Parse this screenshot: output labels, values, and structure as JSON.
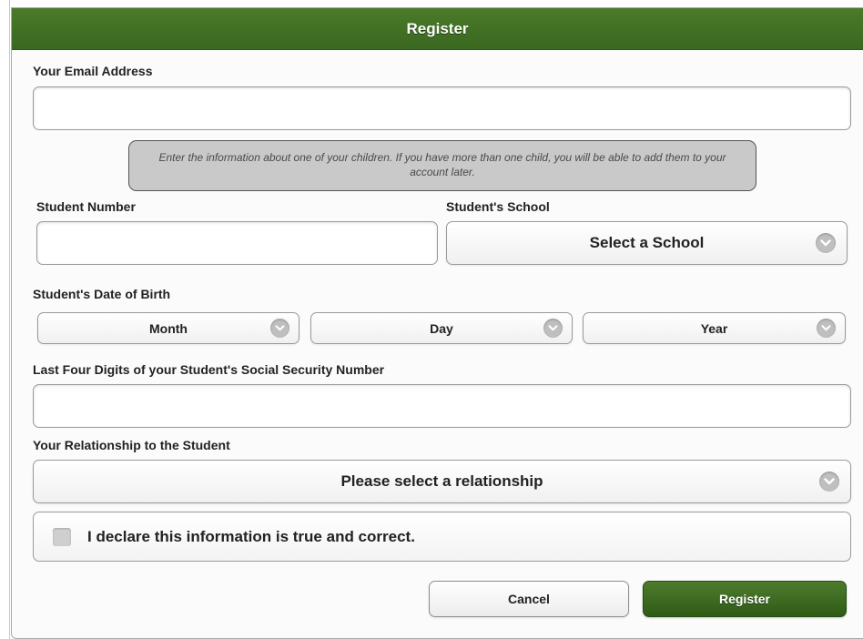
{
  "dialog": {
    "title": "Register"
  },
  "email": {
    "label": "Your Email Address",
    "value": ""
  },
  "note": "Enter the information about one of your children. If you have more than one child, you will be able to add them to your account later.",
  "student_number": {
    "label": "Student Number",
    "value": ""
  },
  "school": {
    "label": "Student's School",
    "selected": "Select a School"
  },
  "dob": {
    "label": "Student's Date of Birth",
    "month": "Month",
    "day": "Day",
    "year": "Year"
  },
  "ssn": {
    "label": "Last Four Digits of your Student's Social Security Number",
    "value": ""
  },
  "relationship": {
    "label": "Your Relationship to the Student",
    "selected": "Please select a relationship"
  },
  "declaration": {
    "label": "I declare this information is true and correct.",
    "checked": false
  },
  "buttons": {
    "cancel": "Cancel",
    "register": "Register"
  },
  "colors": {
    "header_green": "#3f6e24",
    "register_button_green": "#3d6a21"
  },
  "icons": {
    "select_arrow": "chevron-down-icon"
  }
}
